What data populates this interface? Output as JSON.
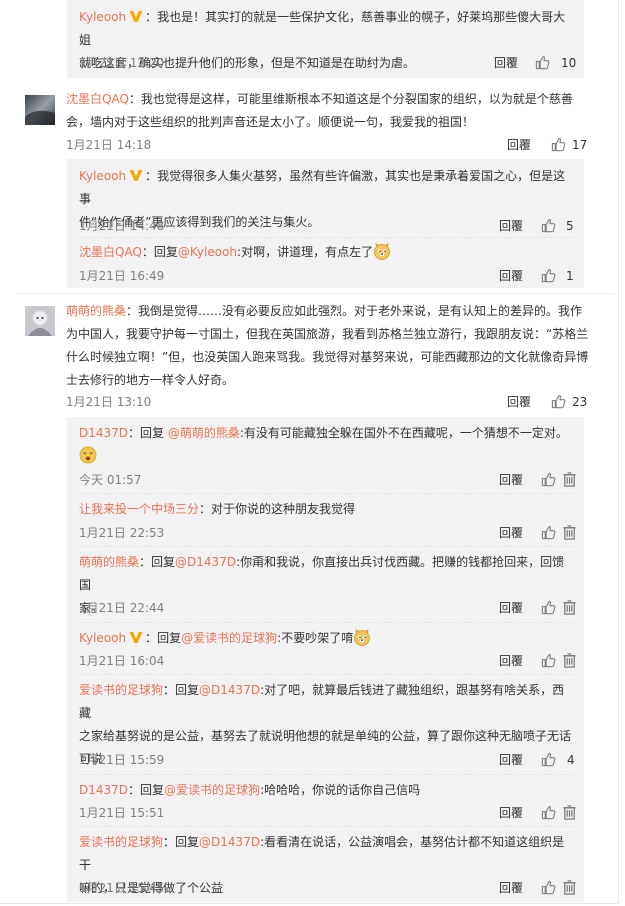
{
  "icons": {
    "like": "thumb-up-icon",
    "delete": "delete-icon",
    "vip": "vip-v-icon",
    "emoji": "doge-emoji-icon",
    "emoji2": "sad-face-emoji-icon"
  },
  "colors": {
    "name": "#eb7350",
    "vip": "#f7a800",
    "reply_bg": "#f2f2f5",
    "meta": "#808080"
  },
  "block1": {
    "c1": {
      "name": "Kyleooh",
      "colon": "：",
      "text_l1": "我也是！其实打的就是一些保护文化，慈善事业的幌子，好莱坞那些傻大哥大姐",
      "text_l2": "就吃这套，确实也提升他们的形象，但是不知道是在助纣为虐。",
      "time": "1月21日 12:20",
      "reply": "回覆",
      "likes": "10"
    }
  },
  "block2": {
    "main": {
      "name": "沈墨白QAQ",
      "colon": "：",
      "text_l1": "我也觉得是这样，可能里维斯根本不知道这是个分裂国家的组织，以为就是个慈善",
      "text_l2": "会，墙内对于这些组织的批判声音还是太小了。顺便说一句，我爱我的祖国！",
      "time": "1月21日 14:18",
      "reply": "回覆",
      "likes": "17"
    },
    "r1": {
      "name": "Kyleooh",
      "colon": "：",
      "text_l1": "我觉得很多人集火基努，虽然有些许偏激，其实也是秉承着爱国之心，但是这事",
      "text_l2": "件“始作俑者”更应该得到我们的关注与集火。",
      "time": "1月21日 14:48",
      "reply": "回覆",
      "likes": "5"
    },
    "r2": {
      "name": "沈墨白QAQ",
      "colon": "：",
      "pre": "回复",
      "at": "@Kyleooh",
      "text": ":对啊，讲道理，有点左了",
      "time": "1月21日 16:49",
      "reply": "回覆",
      "likes": "1"
    }
  },
  "block3": {
    "main": {
      "name": "萌萌的熊桑",
      "colon": "：",
      "text_l1": "我倒是觉得……没有必要反应如此强烈。对于老外来说，是有认知上的差异的。我作",
      "text_l2": "为中国人，我要守护每一寸国土，但我在英国旅游，我看到苏格兰独立游行，我跟朋友说：“苏格兰",
      "text_l3": "什么时候独立啊！”但，也没英国人跑来骂我。我觉得对基努来说，可能西藏那边的文化就像奇异博",
      "text_l4": "士去修行的地方一样令人好奇。",
      "time": "1月21日 13:10",
      "reply": "回覆",
      "likes": "23"
    },
    "r1": {
      "name": "D1437D",
      "colon": "：",
      "pre": "回复 ",
      "at": "@萌萌的熊桑",
      "text": ":有没有可能藏独全躲在国外不在西藏呢，一个猜想不一定对。",
      "time": "今天 01:57",
      "reply": "回覆"
    },
    "r2": {
      "name": "让我来投一个中场三分",
      "colon": "：",
      "text": "对于你说的这种朋友我觉得",
      "time": "1月21日 22:53",
      "reply": "回覆"
    },
    "r3": {
      "name": "萌萌的熊桑",
      "colon": "：",
      "pre": "回复",
      "at": "@D1437D",
      "text_l1": ":你甭和我说，你直接出兵讨伐西藏。把赚的钱都抢回来，回馈国",
      "text_l2": "家。",
      "time": "1月21日 22:44",
      "reply": "回覆"
    },
    "r4": {
      "name": "Kyleooh",
      "colon": "：",
      "pre": "回复",
      "at": "@爱读书的足球狗",
      "text": ":不要吵架了唷",
      "time": "1月21日 16:04",
      "reply": "回覆"
    },
    "r5": {
      "name": "爱读书的足球狗",
      "colon": "：",
      "pre": "回复",
      "at": "@D1437D",
      "text_l1": ":对了吧，就算最后钱进了藏独组织，跟基努有啥关系，西藏",
      "text_l2": "之家给基努说的是公益，基努去了就说明他想的就是单纯的公益，算了跟你这种无脑喷子无话",
      "text_l3": "可说",
      "time": "1月21日 15:59",
      "reply": "回覆",
      "likes": "4"
    },
    "r6": {
      "name": "D1437D",
      "colon": "：",
      "pre": "回复",
      "at": "@爱读书的足球狗",
      "text": ":哈哈哈，你说的话你自己信吗",
      "time": "1月21日 15:51",
      "reply": "回覆"
    },
    "r7": {
      "name": "爱读书的足球狗",
      "colon": "：",
      "pre": "回复",
      "at": "@D1437D",
      "text_l1": ":看看清在说话，公益演唱会，基努估计都不知道这组织是干",
      "text_l2": "嘛的，只是觉得做了个公益",
      "time": "1月21日 15:45",
      "reply": "回覆"
    }
  }
}
